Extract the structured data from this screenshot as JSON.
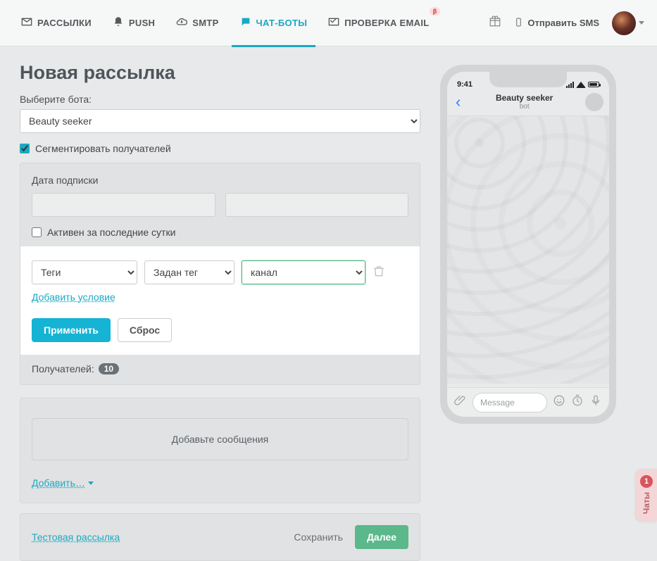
{
  "nav": {
    "items": [
      {
        "label": "РАССЫЛКИ"
      },
      {
        "label": "PUSH"
      },
      {
        "label": "SMTP"
      },
      {
        "label": "ЧАТ-БОТЫ"
      },
      {
        "label": "ПРОВЕРКА EMAIL",
        "badge": "β"
      }
    ],
    "send_sms": "Отправить SMS"
  },
  "page": {
    "title": "Новая рассылка",
    "select_bot_label": "Выберите бота:",
    "bot_selected": "Beauty seeker",
    "segment_label": "Сегментировать получателей"
  },
  "segment": {
    "date_label": "Дата подписки",
    "active_last_day": "Активен за последние сутки",
    "filter": {
      "field": "Теги",
      "operator": "Задан тег",
      "value": "канал"
    },
    "add_condition": "Добавить условие",
    "apply": "Применить",
    "reset": "Сброс",
    "recipients_label": "Получателей:",
    "recipients_count": "10"
  },
  "messages": {
    "placeholder": "Добавьте сообщения",
    "add_label": "Добавить…"
  },
  "actions": {
    "test_send": "Тестовая рассылка",
    "save": "Сохранить",
    "next": "Далее"
  },
  "phone": {
    "time": "9:41",
    "title": "Beauty seeker",
    "subtitle": "bot",
    "input_placeholder": "Message"
  },
  "chat_widget": {
    "count": "1",
    "label": "Чаты"
  }
}
